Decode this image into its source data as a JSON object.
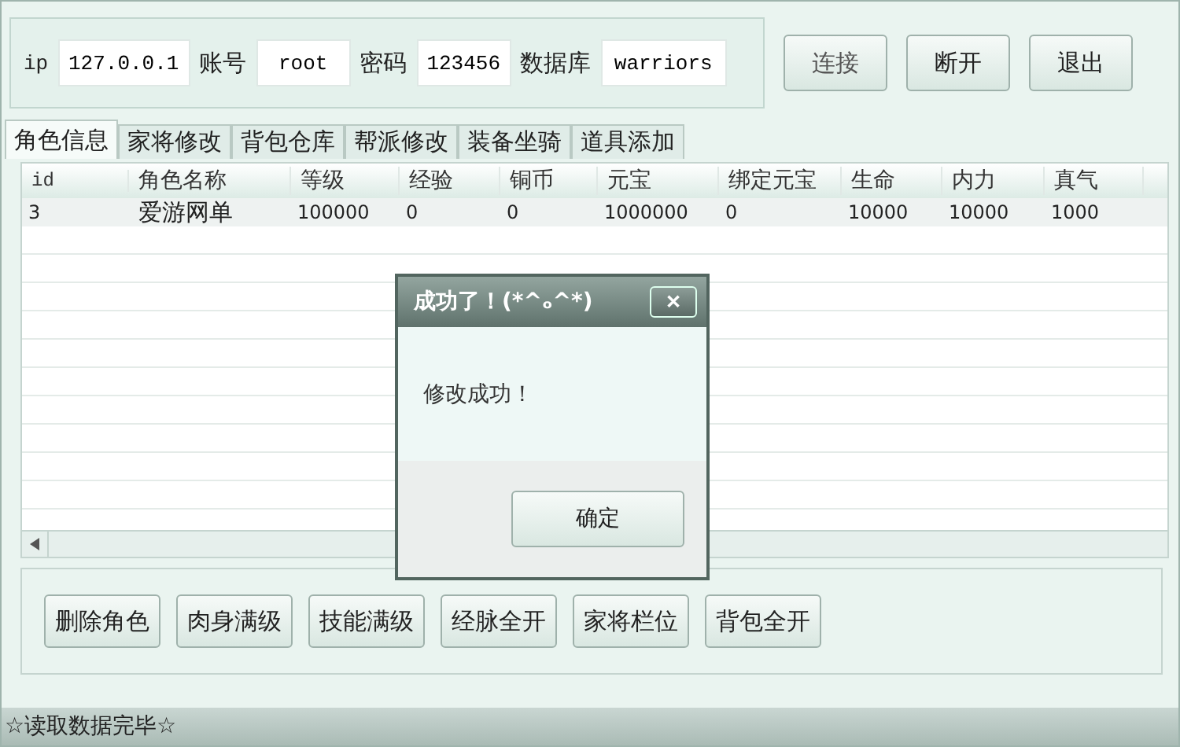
{
  "connection": {
    "fields": [
      {
        "label": "ip",
        "value": "127.0.0.1"
      },
      {
        "label": "账号",
        "value": "root"
      },
      {
        "label": "密码",
        "value": "123456"
      },
      {
        "label": "数据库",
        "value": "warriors"
      }
    ],
    "buttons": [
      "连接",
      "断开",
      "退出"
    ]
  },
  "tabs": [
    {
      "label": "角色信息",
      "selected": true
    },
    {
      "label": "家将修改",
      "selected": false
    },
    {
      "label": "背包仓库",
      "selected": false
    },
    {
      "label": "帮派修改",
      "selected": false
    },
    {
      "label": "装备坐骑",
      "selected": false
    },
    {
      "label": "道具添加",
      "selected": false
    }
  ],
  "table": {
    "columns": [
      "id",
      "角色名称",
      "等级",
      "经验",
      "铜币",
      "元宝",
      "绑定元宝",
      "生命",
      "内力",
      "真气"
    ],
    "rows": [
      [
        "3",
        "爱游网单",
        "100000",
        "0",
        "0",
        "1000000",
        "0",
        "10000",
        "10000",
        "1000"
      ]
    ]
  },
  "dialog": {
    "title": "成功了！(*^ₒ^*)",
    "close": "✕",
    "message": "修改成功！",
    "button": "确定"
  },
  "actions": [
    "删除角色",
    "肉身满级",
    "技能满级",
    "经脉全开",
    "家将栏位",
    "背包全开"
  ],
  "status_bar": "☆读取数据完毕☆"
}
